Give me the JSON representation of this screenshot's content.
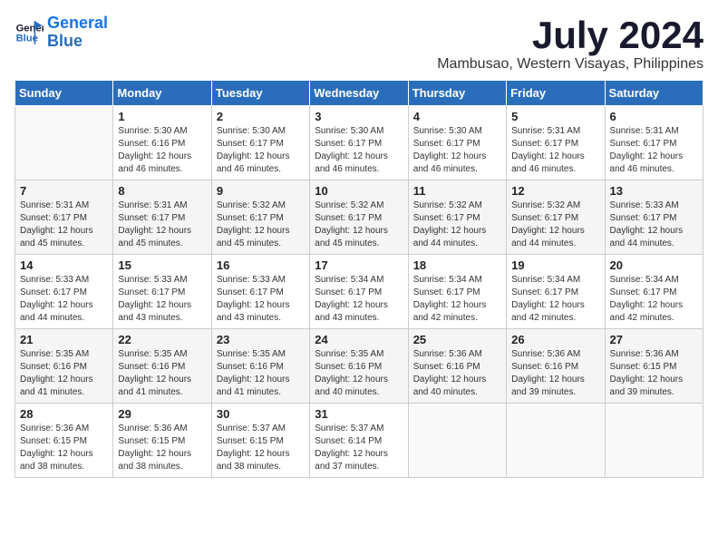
{
  "logo": {
    "line1": "General",
    "line2": "Blue"
  },
  "title": "July 2024",
  "subtitle": "Mambusao, Western Visayas, Philippines",
  "headers": [
    "Sunday",
    "Monday",
    "Tuesday",
    "Wednesday",
    "Thursday",
    "Friday",
    "Saturday"
  ],
  "weeks": [
    [
      {
        "day": "",
        "info": ""
      },
      {
        "day": "1",
        "info": "Sunrise: 5:30 AM\nSunset: 6:16 PM\nDaylight: 12 hours\nand 46 minutes."
      },
      {
        "day": "2",
        "info": "Sunrise: 5:30 AM\nSunset: 6:17 PM\nDaylight: 12 hours\nand 46 minutes."
      },
      {
        "day": "3",
        "info": "Sunrise: 5:30 AM\nSunset: 6:17 PM\nDaylight: 12 hours\nand 46 minutes."
      },
      {
        "day": "4",
        "info": "Sunrise: 5:30 AM\nSunset: 6:17 PM\nDaylight: 12 hours\nand 46 minutes."
      },
      {
        "day": "5",
        "info": "Sunrise: 5:31 AM\nSunset: 6:17 PM\nDaylight: 12 hours\nand 46 minutes."
      },
      {
        "day": "6",
        "info": "Sunrise: 5:31 AM\nSunset: 6:17 PM\nDaylight: 12 hours\nand 46 minutes."
      }
    ],
    [
      {
        "day": "7",
        "info": "Sunrise: 5:31 AM\nSunset: 6:17 PM\nDaylight: 12 hours\nand 45 minutes."
      },
      {
        "day": "8",
        "info": "Sunrise: 5:31 AM\nSunset: 6:17 PM\nDaylight: 12 hours\nand 45 minutes."
      },
      {
        "day": "9",
        "info": "Sunrise: 5:32 AM\nSunset: 6:17 PM\nDaylight: 12 hours\nand 45 minutes."
      },
      {
        "day": "10",
        "info": "Sunrise: 5:32 AM\nSunset: 6:17 PM\nDaylight: 12 hours\nand 45 minutes."
      },
      {
        "day": "11",
        "info": "Sunrise: 5:32 AM\nSunset: 6:17 PM\nDaylight: 12 hours\nand 44 minutes."
      },
      {
        "day": "12",
        "info": "Sunrise: 5:32 AM\nSunset: 6:17 PM\nDaylight: 12 hours\nand 44 minutes."
      },
      {
        "day": "13",
        "info": "Sunrise: 5:33 AM\nSunset: 6:17 PM\nDaylight: 12 hours\nand 44 minutes."
      }
    ],
    [
      {
        "day": "14",
        "info": "Sunrise: 5:33 AM\nSunset: 6:17 PM\nDaylight: 12 hours\nand 44 minutes."
      },
      {
        "day": "15",
        "info": "Sunrise: 5:33 AM\nSunset: 6:17 PM\nDaylight: 12 hours\nand 43 minutes."
      },
      {
        "day": "16",
        "info": "Sunrise: 5:33 AM\nSunset: 6:17 PM\nDaylight: 12 hours\nand 43 minutes."
      },
      {
        "day": "17",
        "info": "Sunrise: 5:34 AM\nSunset: 6:17 PM\nDaylight: 12 hours\nand 43 minutes."
      },
      {
        "day": "18",
        "info": "Sunrise: 5:34 AM\nSunset: 6:17 PM\nDaylight: 12 hours\nand 42 minutes."
      },
      {
        "day": "19",
        "info": "Sunrise: 5:34 AM\nSunset: 6:17 PM\nDaylight: 12 hours\nand 42 minutes."
      },
      {
        "day": "20",
        "info": "Sunrise: 5:34 AM\nSunset: 6:17 PM\nDaylight: 12 hours\nand 42 minutes."
      }
    ],
    [
      {
        "day": "21",
        "info": "Sunrise: 5:35 AM\nSunset: 6:16 PM\nDaylight: 12 hours\nand 41 minutes."
      },
      {
        "day": "22",
        "info": "Sunrise: 5:35 AM\nSunset: 6:16 PM\nDaylight: 12 hours\nand 41 minutes."
      },
      {
        "day": "23",
        "info": "Sunrise: 5:35 AM\nSunset: 6:16 PM\nDaylight: 12 hours\nand 41 minutes."
      },
      {
        "day": "24",
        "info": "Sunrise: 5:35 AM\nSunset: 6:16 PM\nDaylight: 12 hours\nand 40 minutes."
      },
      {
        "day": "25",
        "info": "Sunrise: 5:36 AM\nSunset: 6:16 PM\nDaylight: 12 hours\nand 40 minutes."
      },
      {
        "day": "26",
        "info": "Sunrise: 5:36 AM\nSunset: 6:16 PM\nDaylight: 12 hours\nand 39 minutes."
      },
      {
        "day": "27",
        "info": "Sunrise: 5:36 AM\nSunset: 6:15 PM\nDaylight: 12 hours\nand 39 minutes."
      }
    ],
    [
      {
        "day": "28",
        "info": "Sunrise: 5:36 AM\nSunset: 6:15 PM\nDaylight: 12 hours\nand 38 minutes."
      },
      {
        "day": "29",
        "info": "Sunrise: 5:36 AM\nSunset: 6:15 PM\nDaylight: 12 hours\nand 38 minutes."
      },
      {
        "day": "30",
        "info": "Sunrise: 5:37 AM\nSunset: 6:15 PM\nDaylight: 12 hours\nand 38 minutes."
      },
      {
        "day": "31",
        "info": "Sunrise: 5:37 AM\nSunset: 6:14 PM\nDaylight: 12 hours\nand 37 minutes."
      },
      {
        "day": "",
        "info": ""
      },
      {
        "day": "",
        "info": ""
      },
      {
        "day": "",
        "info": ""
      }
    ]
  ]
}
